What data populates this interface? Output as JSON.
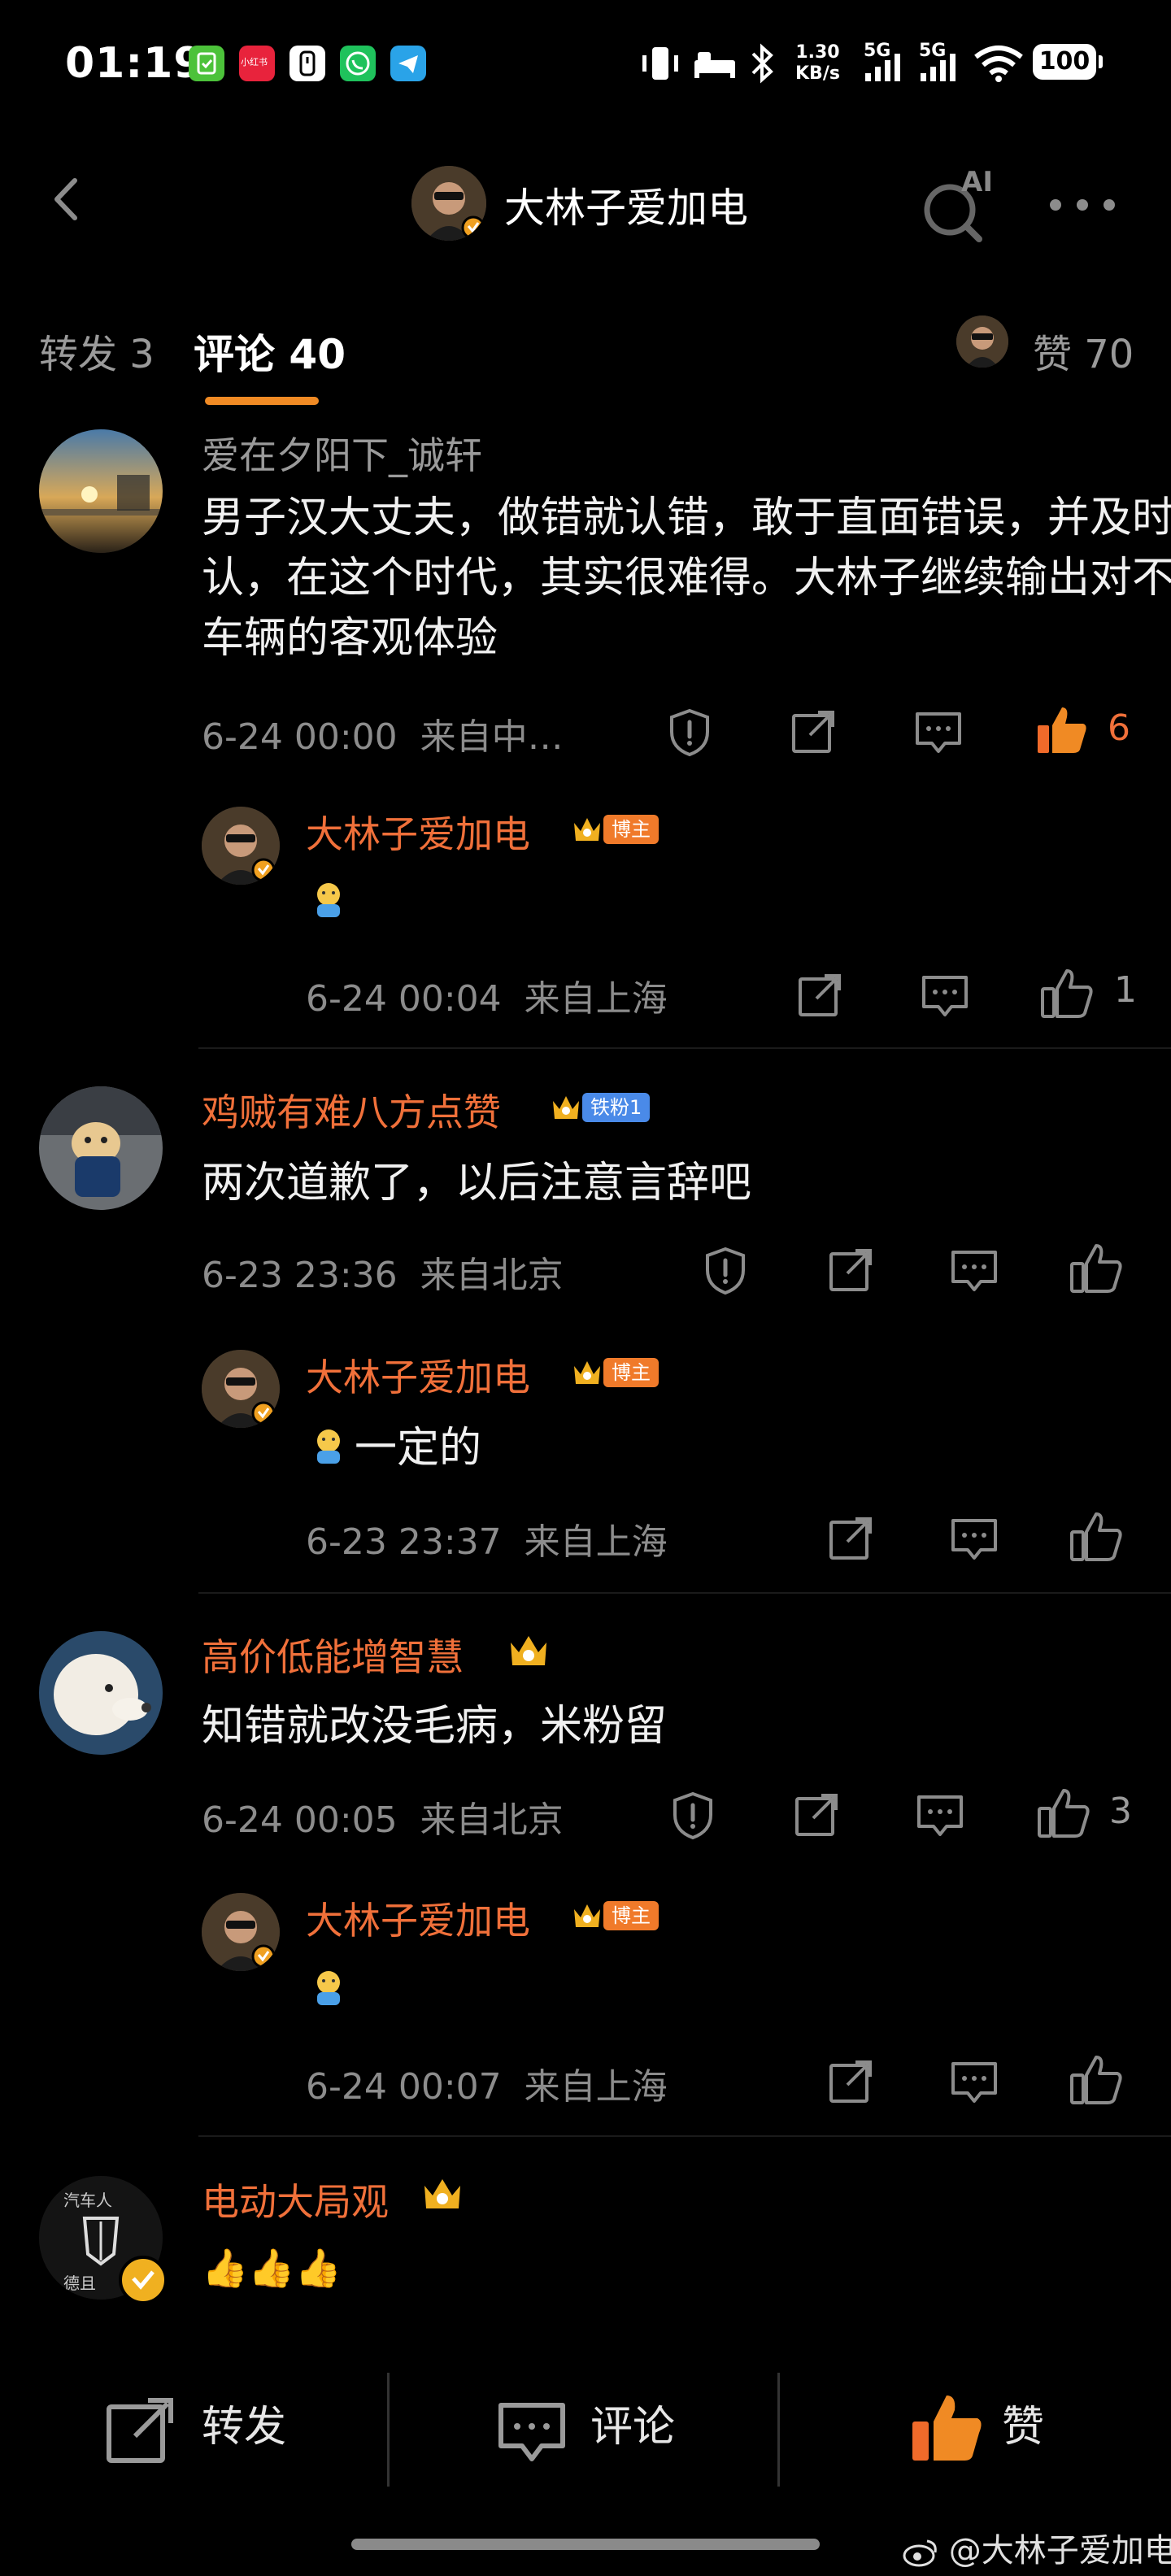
{
  "status_bar": {
    "time": "01:19",
    "net_speed_top": "1.30",
    "net_speed_bottom": "KB/s",
    "sim1": "5G",
    "sim2": "5G",
    "battery": "100",
    "app_icons": [
      "wallet-app-icon",
      "xiaohongshu-app-icon",
      "phone-app-icon",
      "call-app-icon",
      "telegram-app-icon"
    ],
    "app_icon_text_red": "小红书"
  },
  "header": {
    "title": "大林子爱加电",
    "ai_label": "AI"
  },
  "tabs": {
    "forward": "转发 3",
    "comment": "评论 40",
    "like": "赞 70"
  },
  "comments": [
    {
      "username": "爱在夕阳下_诚轩",
      "text": "男子汉大丈夫，做错就认错，敢于直面错误，并及时承认，在这个时代，其实很难得。大林子继续输出对不同车辆的客观体验",
      "date": "6-24 00:00",
      "location": "来自中…",
      "likes": "6",
      "liked": true,
      "reply": {
        "username": "大林子爱加电",
        "badge": "博主",
        "text": "",
        "date": "6-24 00:04",
        "location": "来自上海",
        "likes": "1"
      }
    },
    {
      "username": "鸡贼有难八方点赞",
      "badge": "铁粉1",
      "text": "两次道歉了，以后注意言辞吧",
      "date": "6-23 23:36",
      "location": "来自北京",
      "likes": "",
      "liked": false,
      "reply": {
        "username": "大林子爱加电",
        "badge": "博主",
        "text": "一定的",
        "date": "6-23 23:37",
        "location": "来自上海",
        "likes": ""
      }
    },
    {
      "username": "高价低能增智慧",
      "text": "知错就改没毛病，米粉留",
      "date": "6-24 00:05",
      "location": "来自北京",
      "likes": "3",
      "liked": false,
      "reply": {
        "username": "大林子爱加电",
        "badge": "博主",
        "text": "",
        "date": "6-24 00:07",
        "location": "来自上海",
        "likes": ""
      }
    },
    {
      "username": "电动大局观",
      "avatar_text_top": "汽车人",
      "avatar_text_bottom": "德且",
      "text": "👍👍👍"
    }
  ],
  "bottom_bar": {
    "forward": "转发",
    "comment": "评论",
    "like": "赞"
  },
  "watermark": "@大林子爱加电",
  "colors": {
    "accent_orange": "#f08a24",
    "username_orange": "#f0703a",
    "muted_gray": "#8c8c8c",
    "background": "#000000"
  }
}
